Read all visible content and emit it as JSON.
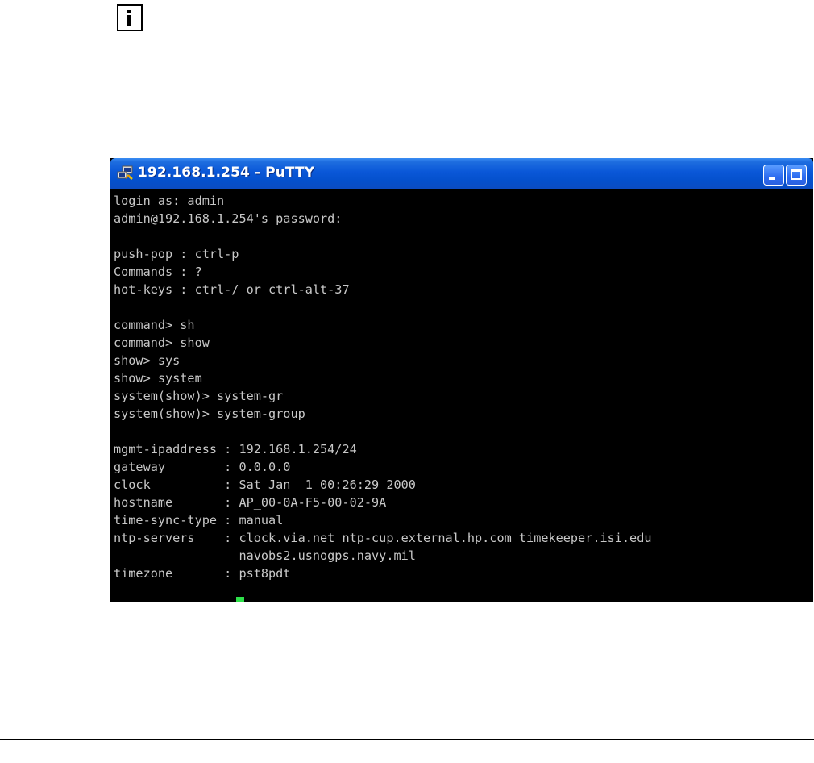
{
  "info_icon": {
    "icon": "info-icon"
  },
  "window": {
    "title": "192.168.1.254 - PuTTY",
    "app_icon": "putty-icon",
    "minimize_icon": "minimize-icon",
    "maximize_icon": "maximize-icon",
    "title_color": "#0450cc"
  },
  "terminal": {
    "text_color": "#c8c8c8",
    "cursor_color": "#2ee04a",
    "lines": [
      "login as: admin",
      "admin@192.168.1.254's password:",
      "",
      "push-pop : ctrl-p",
      "Commands : ?",
      "hot-keys : ctrl-/ or ctrl-alt-37",
      "",
      "command> sh",
      "command> show",
      "show> sys",
      "show> system",
      "system(show)> system-gr",
      "system(show)> system-group",
      "",
      "mgmt-ipaddress : 192.168.1.254/24",
      "gateway        : 0.0.0.0",
      "clock          : Sat Jan  1 00:26:29 2000",
      "hostname       : AP_00-0A-F5-00-02-9A",
      "time-sync-type : manual",
      "ntp-servers    : clock.via.net ntp-cup.external.hp.com timekeeper.isi.edu",
      "                 navobs2.usnogps.navy.mil",
      "timezone       : pst8pdt"
    ]
  }
}
